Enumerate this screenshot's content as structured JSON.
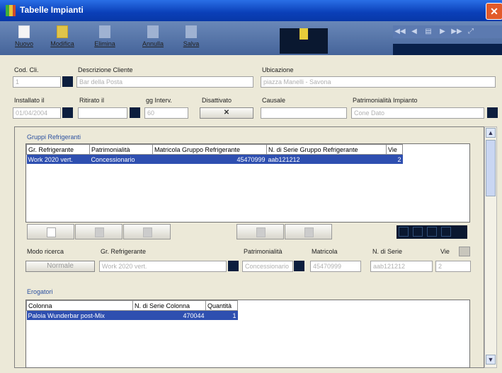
{
  "window": {
    "title": "Tabelle Impianti",
    "close": "✕"
  },
  "toolbar": {
    "nuovo": "Nuovo",
    "modifica": "Modifica",
    "elimina": "Elimina",
    "annulla": "Annulla",
    "salva": "Salva",
    "nav": [
      "◀◀",
      "◀",
      "▤",
      "▶",
      "▶▶",
      "⤢"
    ]
  },
  "form": {
    "cod_cli_label": "Cod. Cli.",
    "cod_cli_value": "1",
    "descr_cliente_label": "Descrizione Cliente",
    "descr_cliente_value": "Bar della Posta",
    "ubicazione_label": "Ubicazione",
    "ubicazione_value": "piazza Manelli - Savona",
    "installato_label": "Installato il",
    "installato_value": "01/04/2004",
    "ritirato_label": "Ritirato il",
    "ritirato_value": "",
    "gg_interv_label": "gg Interv.",
    "gg_interv_value": "60",
    "disattivato_label": "Disattivato",
    "disattivato_value": "✕",
    "causale_label": "Causale",
    "causale_value": "",
    "patrimonialita_label": "Patrimonialità Impianto",
    "patrimonialita_value": "Cone Dato"
  },
  "gruppi": {
    "section_title": "Gruppi Refrigeranti",
    "columns": [
      "Gr. Refrigerante",
      "Patrimonialità",
      "Matricola Gruppo Refrigerante",
      "N. di Serie Gruppo Refrigerante",
      "Vie"
    ],
    "rows": [
      [
        "Work 2020 vert.",
        "Concessionario",
        "45470999",
        "aab121212",
        "2"
      ]
    ],
    "modo_label": "Modo ricerca",
    "modo_button": "Normale",
    "gr_label": "Gr. Refrigerante",
    "gr_value": "Work 2020 vert.",
    "patr_label": "Patrimonialità",
    "patr_value": "Concessionario",
    "matricola_label": "Matricola",
    "matricola_value": "45470999",
    "nserie_label": "N. di Serie",
    "nserie_value": "aab121212",
    "vie_label": "Vie",
    "vie_value": "2"
  },
  "erogatori": {
    "section_title": "Erogatori",
    "columns": [
      "Colonna",
      "N. di Serie Colonna",
      "Quantità"
    ],
    "rows": [
      [
        "Paloia Wunderbar post-Mix",
        "470044",
        "1"
      ]
    ]
  },
  "scroll": {
    "up": "▲",
    "down": "▼"
  }
}
